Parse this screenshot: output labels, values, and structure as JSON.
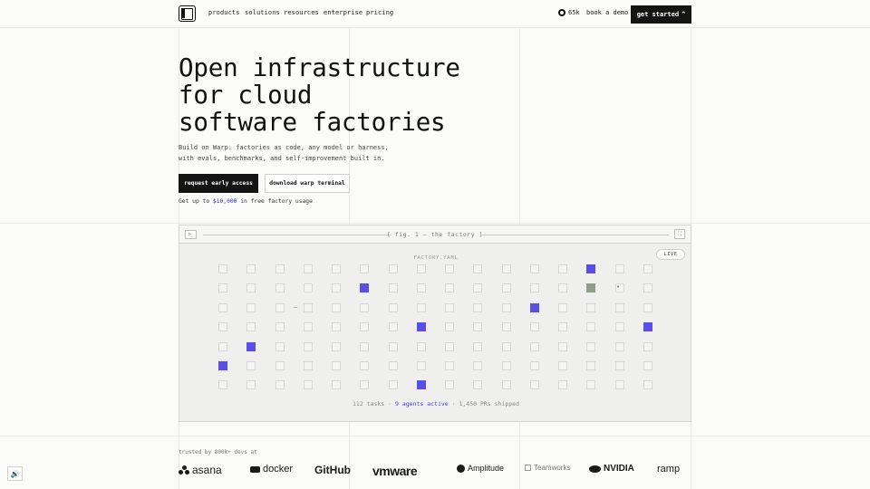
{
  "nav": {
    "products": "products",
    "solutions": "solutions",
    "resources": "resources",
    "enterprise": "enterprise",
    "pricing": "pricing",
    "github_stars": "65k",
    "book_demo": "book a demo",
    "get_started": "get started",
    "get_started_caret": "^"
  },
  "hero": {
    "title_line1": "Open infrastructure",
    "title_line2": "for cloud",
    "title_line3": "software factories",
    "subtitle_line1": "Build on Warp: factories as code, any model or harness,",
    "subtitle_line2": "with evals, benchmarks, and self-improvement built in.",
    "primary_button": "request early access",
    "secondary_button": "download warp terminal",
    "usage_prefix": "Get up to ",
    "usage_amount": "$10,000",
    "usage_suffix": " in free factory usage"
  },
  "figure": {
    "terminal_glyph": ">_",
    "title": "[ fig. 1 — the factory ]",
    "expand_glyph": "⛶",
    "live_badge": "LIVE",
    "yaml_label": "FACTORY.YAML",
    "grid": {
      "rows": 7,
      "cols": 16,
      "active": [
        [
          0,
          13
        ],
        [
          1,
          5
        ],
        [
          2,
          11
        ],
        [
          3,
          7
        ],
        [
          3,
          15
        ],
        [
          4,
          1
        ],
        [
          5,
          0
        ],
        [
          6,
          7
        ]
      ],
      "complete": [
        [
          1,
          13
        ]
      ]
    },
    "stats_tasks": "112 tasks",
    "stats_sep1": "·",
    "stats_agents": "9 agents active",
    "stats_sep2": "·",
    "stats_prs": "1,450 PRs shipped"
  },
  "trusted": {
    "label": "trusted by 800k+ devs at",
    "logos": [
      "asana",
      "docker",
      "GitHub",
      "vmware",
      "Amplitude",
      "Teamworks",
      "NVIDIA",
      "ramp"
    ]
  },
  "sound_icon": "🔊",
  "colors": {
    "accent": "#5b4ee8",
    "complete": "#8f9e89",
    "dark": "#141414",
    "link_blue": "#2b2bc8"
  }
}
